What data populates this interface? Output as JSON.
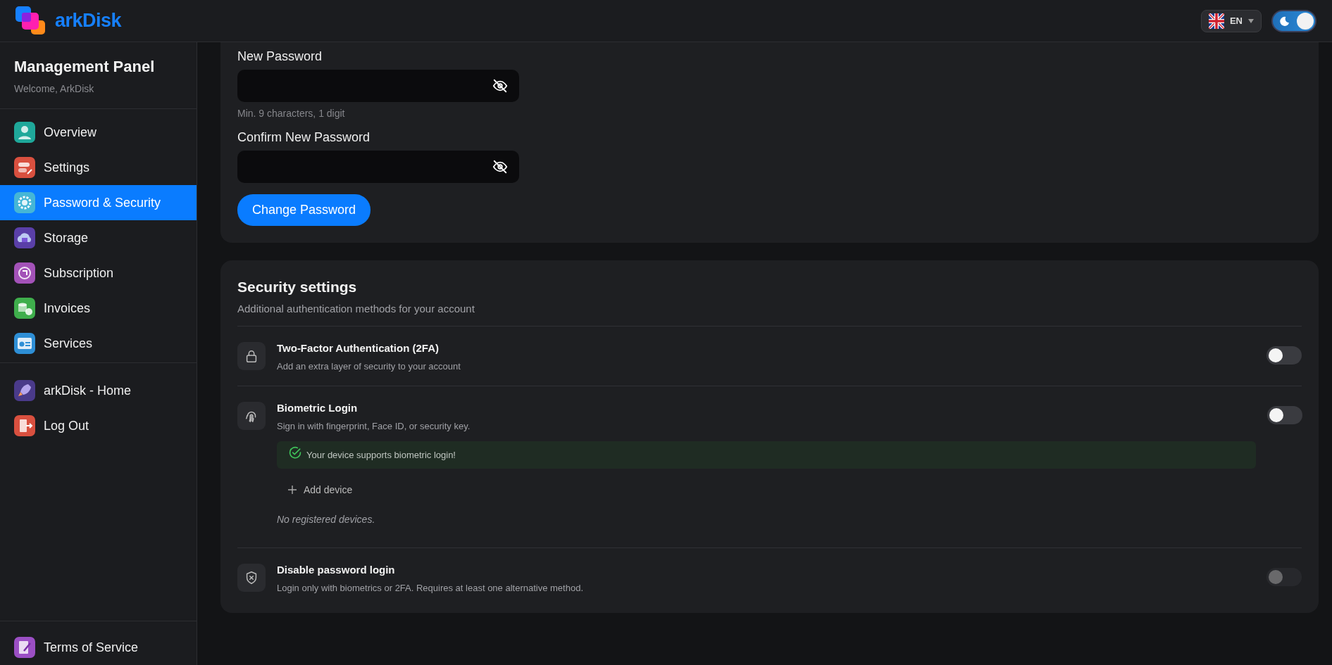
{
  "header": {
    "brand": "arkDisk",
    "language": "EN",
    "dark_mode": true
  },
  "sidebar": {
    "title": "Management Panel",
    "welcome": "Welcome, ArkDisk",
    "items": [
      {
        "label": "Overview",
        "selected": false
      },
      {
        "label": "Settings",
        "selected": false
      },
      {
        "label": "Password & Security",
        "selected": true
      },
      {
        "label": "Storage",
        "selected": false
      },
      {
        "label": "Subscription",
        "selected": false
      },
      {
        "label": "Invoices",
        "selected": false
      },
      {
        "label": "Services",
        "selected": false
      }
    ],
    "links": [
      {
        "label": "arkDisk - Home"
      },
      {
        "label": "Log Out"
      }
    ],
    "footer": {
      "label": "Terms of Service"
    }
  },
  "password_form": {
    "fields": [
      {
        "label": "New Password",
        "hint": "Min. 9 characters, 1 digit"
      },
      {
        "label": "Confirm New Password"
      }
    ],
    "button": "Change Password"
  },
  "security": {
    "title": "Security settings",
    "subtitle": "Additional authentication methods for your account",
    "rows": [
      {
        "title": "Two-Factor Authentication (2FA)",
        "description": "Add an extra layer of security to your account",
        "on": false,
        "disabled": false
      },
      {
        "title": "Biometric Login",
        "description": "Sign in with fingerprint, Face ID, or security key.",
        "on": false,
        "disabled": false,
        "notice": "Your device supports biometric login!",
        "add_button": "Add device",
        "empty_text": "No registered devices."
      },
      {
        "title": "Disable password login",
        "description": "Login only with biometrics or 2FA. Requires at least one alternative method.",
        "on": false,
        "disabled": true
      }
    ]
  }
}
